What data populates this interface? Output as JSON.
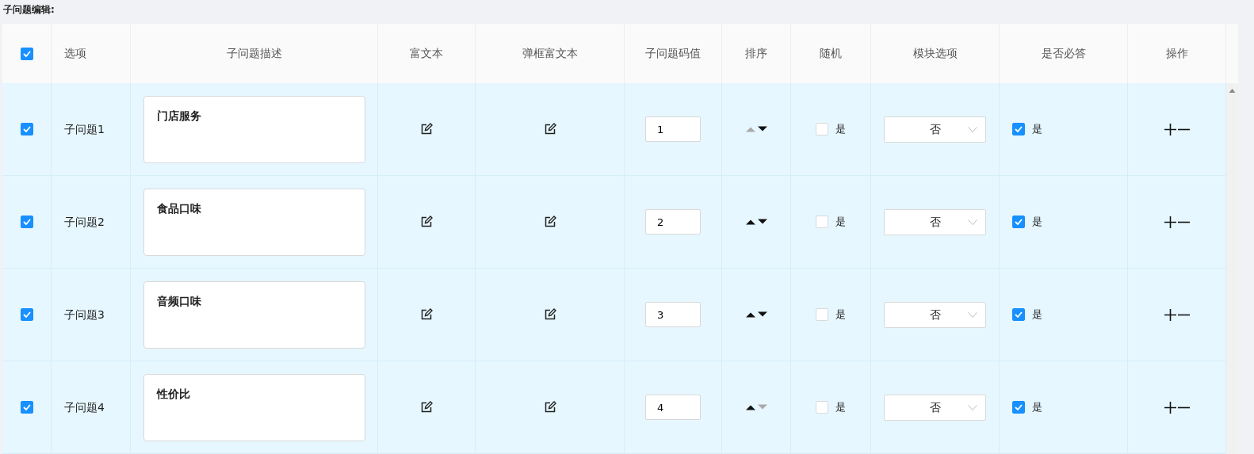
{
  "section_title": "子问题编辑:",
  "header": {
    "select_all": {
      "checked": true
    },
    "columns": [
      "选项",
      "子问题描述",
      "富文本",
      "弹框富文本",
      "子问题码值",
      "排序",
      "随机",
      "模块选项",
      "是否必答",
      "操作"
    ]
  },
  "rows": [
    {
      "checked": true,
      "option": "子问题1",
      "description": "门店服务",
      "code": "1",
      "up_enabled": false,
      "down_enabled": true,
      "random": {
        "checked": false,
        "label": "是"
      },
      "module": "否",
      "required": {
        "checked": true,
        "label": "是"
      }
    },
    {
      "checked": true,
      "option": "子问题2",
      "description": "食品口味",
      "code": "2",
      "up_enabled": true,
      "down_enabled": true,
      "random": {
        "checked": false,
        "label": "是"
      },
      "module": "否",
      "required": {
        "checked": true,
        "label": "是"
      }
    },
    {
      "checked": true,
      "option": "子问题3",
      "description": "音频口味",
      "code": "3",
      "up_enabled": true,
      "down_enabled": true,
      "random": {
        "checked": false,
        "label": "是"
      },
      "module": "否",
      "required": {
        "checked": true,
        "label": "是"
      }
    },
    {
      "checked": true,
      "option": "子问题4",
      "description": "性价比",
      "code": "4",
      "up_enabled": true,
      "down_enabled": false,
      "random": {
        "checked": false,
        "label": "是"
      },
      "module": "否",
      "required": {
        "checked": true,
        "label": "是"
      }
    }
  ]
}
